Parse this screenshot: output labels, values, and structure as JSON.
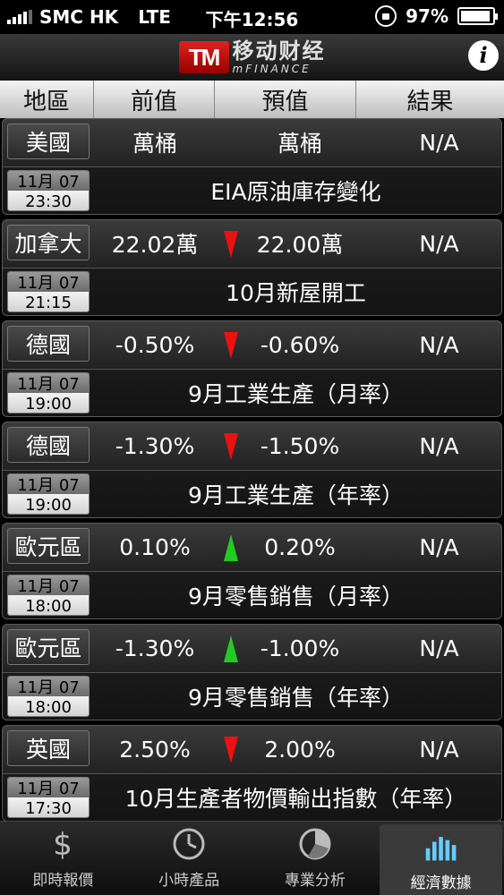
{
  "status_bar": {
    "carrier": "SMC HK",
    "network": "LTE",
    "time": "下午12:56",
    "battery": "97%",
    "battery_level": 0.97
  },
  "header": {
    "logo_cn": "移动财经",
    "logo_en": "mFINANCE",
    "logo_mark": "TM",
    "info_icon": "i"
  },
  "columns": {
    "region": "地區",
    "previous": "前值",
    "forecast": "預值",
    "result": "結果"
  },
  "rows": [
    {
      "region": "美國",
      "previous": "萬桶",
      "arrow": "none",
      "forecast": "萬桶",
      "result": "N/A",
      "date": "11月 07",
      "time": "23:30",
      "event": "EIA原油庫存變化"
    },
    {
      "region": "加拿大",
      "previous": "22.02萬",
      "arrow": "down",
      "forecast": "22.00萬",
      "result": "N/A",
      "date": "11月 07",
      "time": "21:15",
      "event": "10月新屋開工"
    },
    {
      "region": "德國",
      "previous": "-0.50%",
      "arrow": "down",
      "forecast": "-0.60%",
      "result": "N/A",
      "date": "11月 07",
      "time": "19:00",
      "event": "9月工業生產（月率）"
    },
    {
      "region": "德國",
      "previous": "-1.30%",
      "arrow": "down",
      "forecast": "-1.50%",
      "result": "N/A",
      "date": "11月 07",
      "time": "19:00",
      "event": "9月工業生產（年率）"
    },
    {
      "region": "歐元區",
      "previous": "0.10%",
      "arrow": "up",
      "forecast": "0.20%",
      "result": "N/A",
      "date": "11月 07",
      "time": "18:00",
      "event": "9月零售銷售（月率）"
    },
    {
      "region": "歐元區",
      "previous": "-1.30%",
      "arrow": "up",
      "forecast": "-1.00%",
      "result": "N/A",
      "date": "11月 07",
      "time": "18:00",
      "event": "9月零售銷售（年率）"
    },
    {
      "region": "英國",
      "previous": "2.50%",
      "arrow": "down",
      "forecast": "2.00%",
      "result": "N/A",
      "date": "11月 07",
      "time": "17:30",
      "event": "10月生產者物價輸出指數（年率）"
    }
  ],
  "tabs": [
    {
      "label": "即時報價",
      "icon": "dollar-icon",
      "active": false
    },
    {
      "label": "小時產品",
      "icon": "clock-icon",
      "active": false
    },
    {
      "label": "專業分析",
      "icon": "pie-chart-icon",
      "active": false
    },
    {
      "label": "經濟數據",
      "icon": "bar-chart-icon",
      "active": true
    }
  ],
  "colors": {
    "arrow_up": "#22cc22",
    "arrow_down": "#ee1111",
    "brand_red": "#cc2222"
  }
}
